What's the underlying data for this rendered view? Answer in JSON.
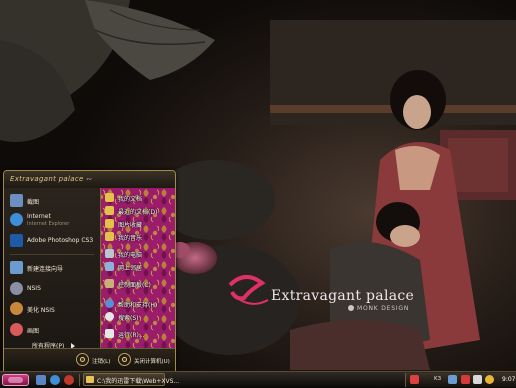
{
  "desktop": {
    "brand_text": "Extravagant palace",
    "brand_sub": "MONK DESIGN"
  },
  "start_menu": {
    "header_title": "Extravagant palace",
    "pinned": [
      {
        "title": "截图",
        "subtitle": "",
        "icon": "screenshot-icon",
        "color": "#6a8fc0"
      },
      {
        "title": "Internet",
        "subtitle": "Internet Explorer",
        "icon": "internet-explorer-icon",
        "color": "#3f8fd8"
      },
      {
        "title": "Adobe Photoshop CS3",
        "subtitle": "",
        "icon": "photoshop-icon",
        "color": "#1f5aa6"
      }
    ],
    "recent": [
      {
        "title": "新建连接向导",
        "icon": "connection-wizard-icon",
        "color": "#6a9cd0"
      },
      {
        "title": "NSIS",
        "icon": "nsis-icon",
        "color": "#8a8fa8"
      },
      {
        "title": "美化 NSIS",
        "icon": "nsis-beautify-icon",
        "color": "#c88a3a"
      },
      {
        "title": "画图",
        "icon": "paint-icon",
        "color": "#d85a5a"
      }
    ],
    "all_programs": "所有程序(P)",
    "right_items": [
      {
        "label": "我的文档",
        "icon": "documents-icon",
        "color": "#e3c24a"
      },
      {
        "label": "最近的文档(D)",
        "icon": "recent-docs-icon",
        "color": "#e3c24a"
      },
      {
        "label": "图片收藏",
        "icon": "pictures-icon",
        "color": "#e3c24a"
      },
      {
        "label": "我的音乐",
        "icon": "music-icon",
        "color": "#e3c24a"
      },
      {
        "label": "我的电脑",
        "icon": "computer-icon",
        "color": "#b9c4d4"
      },
      {
        "label": "网上邻居",
        "icon": "network-icon",
        "color": "#8fb0d8"
      },
      {
        "label": "控制面板(C)",
        "icon": "control-panel-icon",
        "color": "#c9b07a"
      },
      {
        "label": "帮助和支持(H)",
        "icon": "help-icon",
        "color": "#5a8fd8"
      },
      {
        "label": "搜索(S)",
        "icon": "search-icon",
        "color": "#e6e6e6"
      },
      {
        "label": "运行(R)...",
        "icon": "run-icon",
        "color": "#e6e6e6"
      }
    ],
    "footer": {
      "logoff_label": "注销(L)",
      "shutdown_label": "关闭计算机(U)"
    }
  },
  "taskbar": {
    "quick_launch": [
      {
        "icon": "show-desktop-icon",
        "color": "#5a86c8"
      },
      {
        "icon": "ie-quick-icon",
        "color": "#3f8fd8"
      },
      {
        "icon": "media-player-icon",
        "color": "#c0392b"
      }
    ],
    "task_label": "C:\\我的迅雷下载\\Web+XVS...",
    "tray": {
      "lang": "K3",
      "clock": "9:07",
      "icons": [
        {
          "icon": "ime-icon",
          "color": "#e04040"
        },
        {
          "icon": "network-tray-icon",
          "color": "#6a9cd0"
        },
        {
          "icon": "volume-icon",
          "color": "#d8d8d8"
        },
        {
          "icon": "antivirus-icon",
          "color": "#d83a3a"
        },
        {
          "icon": "security-icon",
          "color": "#e8b43a"
        }
      ]
    }
  }
}
